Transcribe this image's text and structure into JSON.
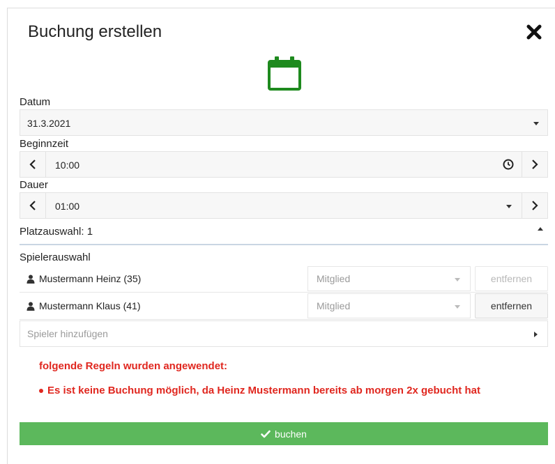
{
  "dialog": {
    "title": "Buchung erstellen",
    "close_icon": "close-icon",
    "header_icon": "calendar-icon",
    "accent_color": "#1e8a1e"
  },
  "date": {
    "label": "Datum",
    "value": "31.3.2021"
  },
  "start_time": {
    "label": "Beginnzeit",
    "value": "10:00",
    "prev_icon": "chevron-left-icon",
    "next_icon": "chevron-right-icon",
    "clock_icon": "clock-icon"
  },
  "duration": {
    "label": "Dauer",
    "value": "01:00"
  },
  "court": {
    "label": "Platzauswahl: 1",
    "expanded": true
  },
  "players": {
    "label": "Spielerauswahl",
    "items": [
      {
        "name": "Mustermann Heinz (35)",
        "role": "Mitglied",
        "remove_label": "entfernen",
        "remove_enabled": false
      },
      {
        "name": "Mustermann Klaus (41)",
        "role": "Mitglied",
        "remove_label": "entfernen",
        "remove_enabled": true
      }
    ],
    "add_placeholder": "Spieler hinzufügen"
  },
  "rules": {
    "title": "folgende Regeln wurden angewendet:",
    "items": [
      "Es ist keine Buchung möglich, da Heinz Mustermann bereits ab morgen 2x gebucht hat"
    ],
    "color": "#e0271f"
  },
  "submit": {
    "label": "buchen",
    "color": "#5cb85c"
  }
}
